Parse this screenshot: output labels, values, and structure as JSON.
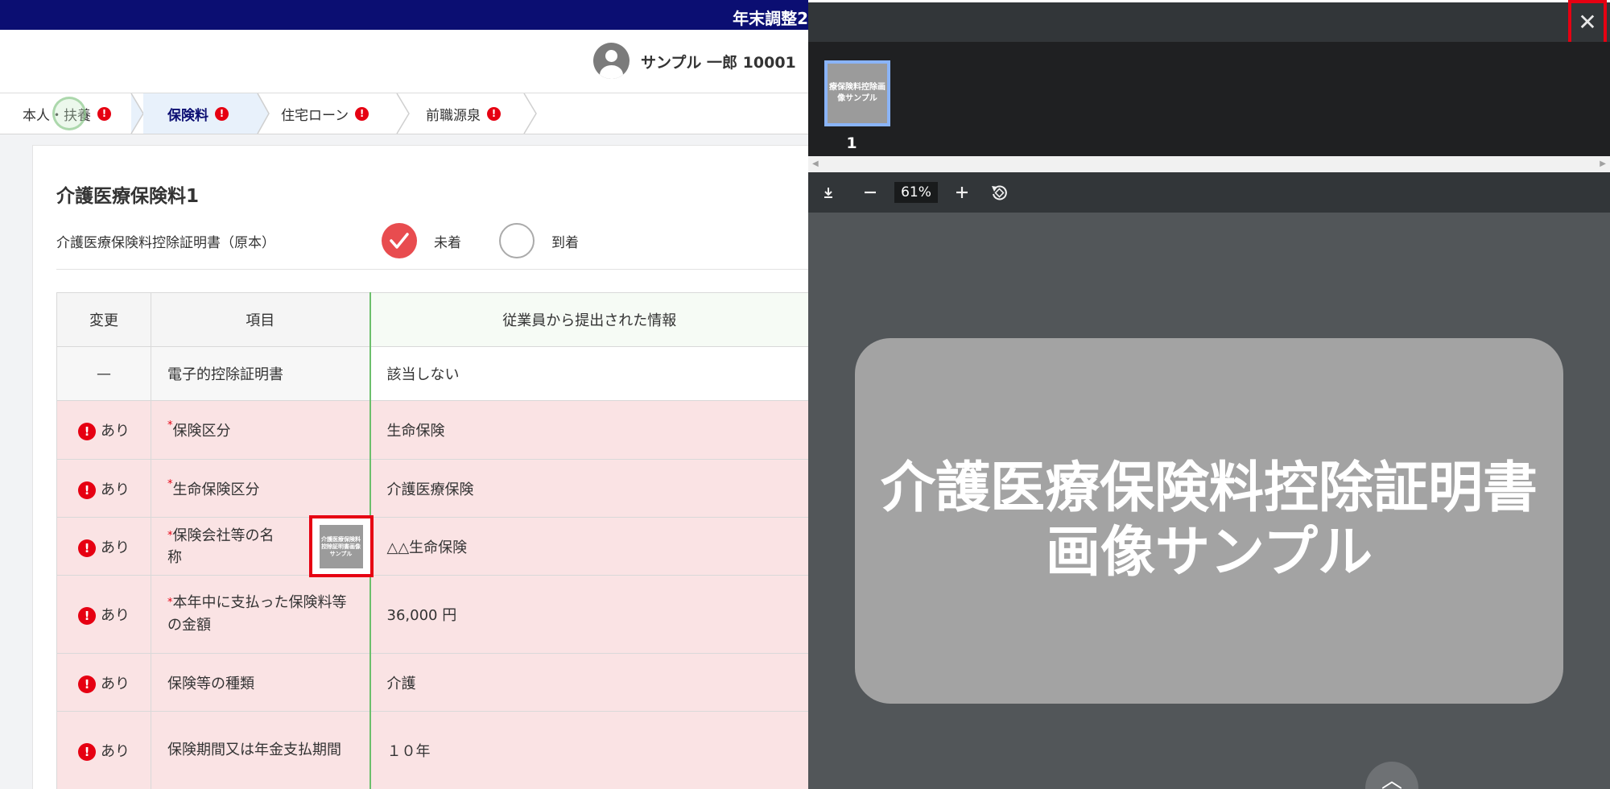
{
  "app": {
    "title": "年末調整2",
    "user": "サンプル 一郎  10001",
    "steps": [
      {
        "label": "本人・扶養",
        "alert": "!"
      },
      {
        "label": "保険料",
        "alert": "!"
      },
      {
        "label": "住宅ローン",
        "alert": "!"
      },
      {
        "label": "前職源泉",
        "alert": "!"
      }
    ],
    "section_title": "介護医療保険料1",
    "certificate_label": "介護医療保険料控除証明書（原本）",
    "radio_unarrived": "未着",
    "radio_arrived": "到着",
    "table": {
      "headers": {
        "change": "変更",
        "item": "項目",
        "submitted": "従業員から提出された情報"
      },
      "rows": [
        {
          "change": "—",
          "required": "",
          "item": "電子的控除証明書",
          "value": "該当しない"
        },
        {
          "change": "あり",
          "required": "*",
          "item": "保険区分",
          "value": "生命保険"
        },
        {
          "change": "あり",
          "required": "*",
          "item": "生命保険区分",
          "value": "介護医療保険"
        },
        {
          "change": "あり",
          "required": "*",
          "item": "保険会社等の名称",
          "value": "△△生命保険"
        },
        {
          "change": "あり",
          "required": "*",
          "item": "本年中に支払った保険料等の金額",
          "value": "36,000 円"
        },
        {
          "change": "あり",
          "required": "",
          "item": "保険等の種類",
          "value": "介護"
        },
        {
          "change": "あり",
          "required": "",
          "item": "保険期間又は年金支払期間",
          "value": "１０年"
        }
      ],
      "thumb_text": "介護医療保険料控除証明書画像サンプル"
    }
  },
  "viewer": {
    "close": "✕",
    "page_thumb_text": "療保険料控除画像サンプル",
    "page_number": "1",
    "zoom": "61%",
    "doc_line1": "介護医療保険料控除証明書",
    "doc_line2": "画像サンプル",
    "icons": [
      "download-icon",
      "zoom-out-icon",
      "zoom-in-icon",
      "rotate-icon",
      "scroll-up-icon"
    ]
  }
}
